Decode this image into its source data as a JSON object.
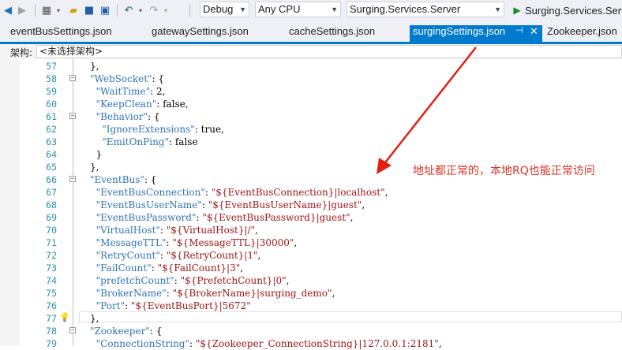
{
  "toolbar": {
    "config": "Debug",
    "platform": "Any CPU",
    "startup_project": "Surging.Services.Server",
    "run_label": "Surging.Services.Serv"
  },
  "tabs": [
    {
      "label": "eventBusSettings.json"
    },
    {
      "label": "gatewaySettings.json"
    },
    {
      "label": "cacheSettings.json"
    },
    {
      "label": "surgingSettings.json",
      "active": true
    },
    {
      "label": "Zookeeper.json"
    }
  ],
  "nav": {
    "label": "架构:",
    "value": "<未选择架构>"
  },
  "code_lines": [
    {
      "n": "57",
      "text": "},"
    },
    {
      "n": "58",
      "text": "\"WebSocket\": {"
    },
    {
      "n": "59",
      "text": "  \"WaitTime\": 2,"
    },
    {
      "n": "60",
      "text": "  \"KeepClean\": false,"
    },
    {
      "n": "61",
      "text": "  \"Behavior\": {"
    },
    {
      "n": "62",
      "text": "    \"IgnoreExtensions\": true,"
    },
    {
      "n": "63",
      "text": "    \"EmitOnPing\": false"
    },
    {
      "n": "64",
      "text": "  }"
    },
    {
      "n": "65",
      "text": "},"
    },
    {
      "n": "66",
      "text": "\"EventBus\": {"
    },
    {
      "n": "67",
      "text": "  \"EventBusConnection\": \"${EventBusConnection}|localhost\","
    },
    {
      "n": "68",
      "text": "  \"EventBusUserName\": \"${EventBusUserName}|guest\","
    },
    {
      "n": "69",
      "text": "  \"EventBusPassword\": \"${EventBusPassword}|guest\","
    },
    {
      "n": "70",
      "text": "  \"VirtualHost\": \"${VirtualHost}|/\","
    },
    {
      "n": "71",
      "text": "  \"MessageTTL\": \"${MessageTTL}|30000\","
    },
    {
      "n": "72",
      "text": "  \"RetryCount\": \"${RetryCount}|1\","
    },
    {
      "n": "73",
      "text": "  \"FailCount\": \"${FailCount}|3\","
    },
    {
      "n": "74",
      "text": "  \"prefetchCount\": \"${PrefetchCount}|0\","
    },
    {
      "n": "75",
      "text": "  \"BrokerName\": \"${BrokerName}|surging_demo\","
    },
    {
      "n": "76",
      "text": "  \"Port\": \"${EventBusPort}|5672\""
    },
    {
      "n": "77",
      "text": "},"
    },
    {
      "n": "78",
      "text": "\"Zookeeper\": {"
    },
    {
      "n": "79",
      "text": "  \"ConnectionString\": \"${Zookeeper_ConnectionString}|127.0.0.1:2181\","
    }
  ],
  "annotation": "地址都正常的，本地RQ也能正常访问",
  "colors": {
    "accent": "#007acc",
    "key": "#2e75b6",
    "string": "#a31515",
    "line_number": "#2b91af",
    "annotation": "#e03020"
  }
}
